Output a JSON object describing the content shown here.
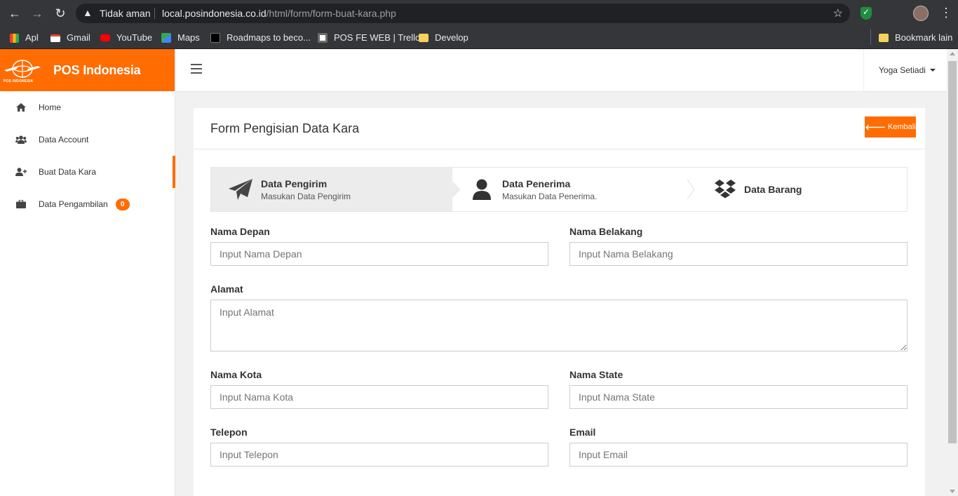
{
  "browser": {
    "security_text": "Tidak aman",
    "url_host": "local.posindonesia.co.id",
    "url_path": "/html/form/form-buat-kara.php",
    "bookmarks": [
      {
        "label": "Apl",
        "icon": "apps-grid-icon",
        "color": "#e94235"
      },
      {
        "label": "Gmail",
        "icon": "gmail-icon",
        "color": "#ea4335"
      },
      {
        "label": "YouTube",
        "icon": "youtube-icon",
        "color": "#ff0000"
      },
      {
        "label": "Maps",
        "icon": "maps-icon",
        "color": "#34a853"
      },
      {
        "label": "Roadmaps to beco...",
        "icon": "roadmap-icon",
        "color": "#000000"
      },
      {
        "label": "POS FE WEB | Trello",
        "icon": "trello-icon",
        "color": "#ffffff"
      },
      {
        "label": "Develop",
        "icon": "folder-icon",
        "color": "#f6d25b"
      }
    ],
    "other_bookmarks": "Bookmark lain"
  },
  "sidebar": {
    "brand_name": "POS Indonesia",
    "logo_text": "POS INDONESIA",
    "items": [
      {
        "label": "Home",
        "icon": "home-icon"
      },
      {
        "label": "Data Account",
        "icon": "users-icon"
      },
      {
        "label": "Buat Data Kara",
        "icon": "user-plus-icon"
      },
      {
        "label": "Data Pengambilan",
        "icon": "briefcase-icon",
        "badge": "0"
      }
    ]
  },
  "topbar": {
    "user_name": "Yoga Setiadi"
  },
  "panel": {
    "title": "Form Pengisian Data Kara",
    "back_label": "Kembali"
  },
  "steps": [
    {
      "title": "Data Pengirim",
      "subtitle": "Masukan Data Pengirim",
      "icon": "paper-plane-icon"
    },
    {
      "title": "Data Penerima",
      "subtitle": "Masukan Data Penerima.",
      "icon": "user-icon"
    },
    {
      "title": "Data Barang",
      "subtitle": "",
      "icon": "dropbox-icon"
    }
  ],
  "form": {
    "nama_depan": {
      "label": "Nama Depan",
      "placeholder": "Input Nama Depan",
      "value": ""
    },
    "nama_belakang": {
      "label": "Nama Belakang",
      "placeholder": "Input Nama Belakang",
      "value": ""
    },
    "alamat": {
      "label": "Alamat",
      "placeholder": "Input Alamat",
      "value": ""
    },
    "nama_kota": {
      "label": "Nama Kota",
      "placeholder": "Input Nama Kota",
      "value": ""
    },
    "nama_state": {
      "label": "Nama State",
      "placeholder": "Input Nama State",
      "value": ""
    },
    "telepon": {
      "label": "Telepon",
      "placeholder": "Input Telepon",
      "value": ""
    },
    "email": {
      "label": "Email",
      "placeholder": "Input Email",
      "value": ""
    }
  },
  "colors": {
    "accent": "#ff6c02",
    "step_active_bg": "#ececec"
  }
}
